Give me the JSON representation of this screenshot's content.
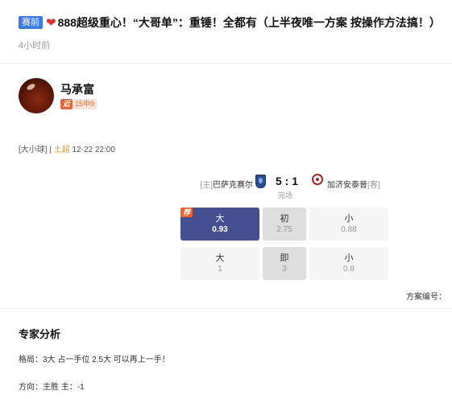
{
  "header": {
    "tag": "赛前",
    "title": "888超级重心！“大哥单”：重锤！全都有（上半夜唯一方案 按操作方法搞！）",
    "time": "4小时前"
  },
  "author": {
    "name": "马承富",
    "streak_icon": "近",
    "streak_text": "15中9"
  },
  "match": {
    "type": "[大小球]",
    "separator": " | ",
    "league": "土超",
    "datetime": " 12-22 22:00",
    "home_tag": "[主]",
    "home_team": "巴萨克赛尔",
    "score": "5 : 1",
    "status": "完场",
    "away_team": "加济安泰普",
    "away_tag": "[客]"
  },
  "odds": {
    "recommend_badge": "荐",
    "initial": {
      "big_label": "大",
      "big_value": "0.93",
      "mid_label": "初",
      "mid_value": "2.75",
      "small_label": "小",
      "small_value": "0.88"
    },
    "live": {
      "big_label": "大",
      "big_value": "1",
      "mid_label": "即",
      "mid_value": "3",
      "small_label": "小",
      "small_value": "0.8"
    }
  },
  "scheme_label": "方案编号：",
  "analysis": {
    "title": "专家分析",
    "line1": "格局：3大 占一手位 2.5大 可以再上一手！",
    "line2": "方向：主胜 主：-1"
  },
  "colors": {
    "accent": "#465090",
    "tag_blue": "#3b7be8",
    "orange": "#f0622c",
    "heart": "#e0322f"
  },
  "icons": [
    "heart-icon",
    "avatar",
    "home-team-logo",
    "away-team-logo"
  ]
}
